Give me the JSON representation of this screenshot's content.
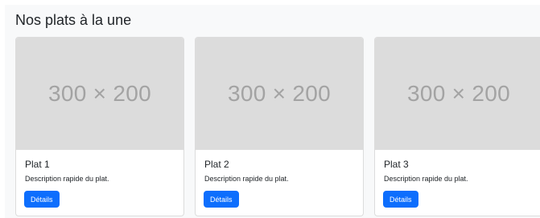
{
  "section": {
    "title": "Nos plats à la une"
  },
  "cards": [
    {
      "image_text": "300 × 200",
      "title": "Plat 1",
      "description": "Description rapide du plat.",
      "button_label": "Détails"
    },
    {
      "image_text": "300 × 200",
      "title": "Plat 2",
      "description": "Description rapide du plat.",
      "button_label": "Détails"
    },
    {
      "image_text": "300 × 200",
      "title": "Plat 3",
      "description": "Description rapide du plat.",
      "button_label": "Détails"
    }
  ],
  "colors": {
    "button": "#0d6efd",
    "placeholder": "#dcdcdc"
  }
}
